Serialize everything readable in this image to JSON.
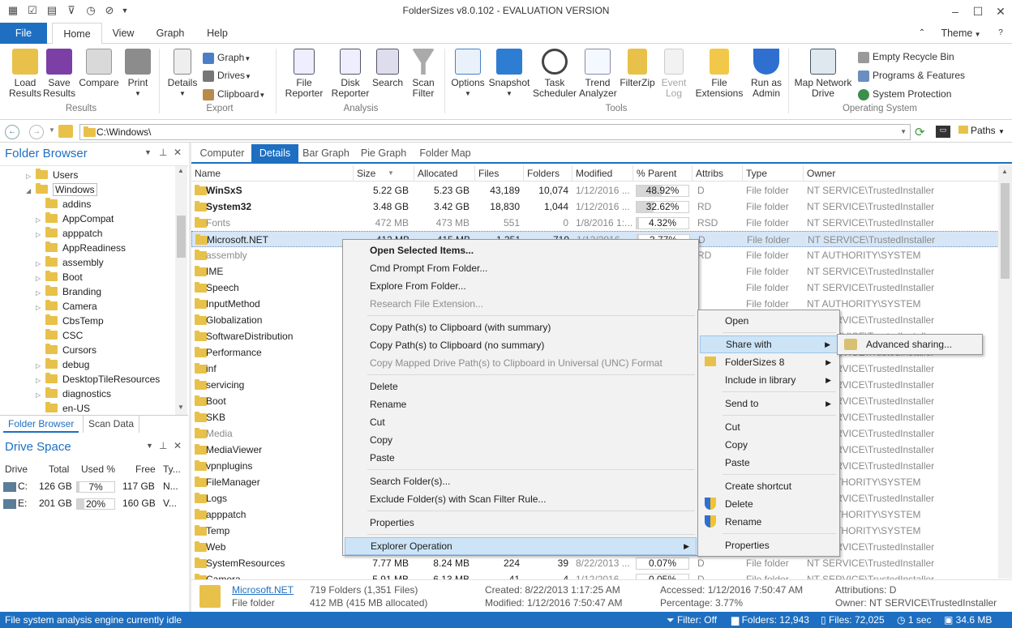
{
  "window": {
    "title": "FolderSizes v8.0.102 - EVALUATION VERSION"
  },
  "ribbon_tabs": {
    "file": "File",
    "home": "Home",
    "view": "View",
    "graph": "Graph",
    "help": "Help",
    "theme": "Theme"
  },
  "ribbon": {
    "load_results": "Load Results",
    "save_results": "Save Results",
    "compare": "Compare",
    "print": "Print",
    "results_group": "Results",
    "details": "Details",
    "graph": "Graph",
    "drives": "Drives",
    "clipboard": "Clipboard",
    "export_group": "Export",
    "file_reporter": "File Reporter",
    "disk_reporter": "Disk Reporter",
    "search": "Search",
    "scan_filter": "Scan Filter",
    "analysis_group": "Analysis",
    "options": "Options",
    "snapshot": "Snapshot",
    "task_scheduler": "Task Scheduler",
    "trend_analyzer": "Trend Analyzer",
    "filterzip": "FilterZip",
    "event_log": "Event Log",
    "file_extensions": "File Extensions",
    "run_as_admin": "Run as Admin",
    "tools_group": "Tools",
    "map_network_drive": "Map Network Drive",
    "empty_recycle_bin": "Empty Recycle Bin",
    "programs_features": "Programs & Features",
    "system_protection": "System Protection",
    "os_group": "Operating System"
  },
  "address": {
    "path": "C:\\Windows\\",
    "paths_label": "Paths"
  },
  "folder_browser": {
    "title": "Folder Browser",
    "items": [
      "Users",
      "Windows",
      "addins",
      "AppCompat",
      "apppatch",
      "AppReadiness",
      "assembly",
      "Boot",
      "Branding",
      "Camera",
      "CbsTemp",
      "CSC",
      "Cursors",
      "debug",
      "DesktopTileResources",
      "diagnostics",
      "en-US"
    ],
    "tab_browser": "Folder Browser",
    "tab_scan": "Scan Data"
  },
  "drive_space": {
    "title": "Drive Space",
    "headers": [
      "Drive",
      "Total",
      "Used %",
      "Free",
      "Ty..."
    ],
    "drives": [
      {
        "drive": "C:",
        "total": "126 GB",
        "used": "7%",
        "used_frac": 0.07,
        "free": "117 GB",
        "type": "N..."
      },
      {
        "drive": "E:",
        "total": "201 GB",
        "used": "20%",
        "used_frac": 0.2,
        "free": "160 GB",
        "type": "V..."
      }
    ]
  },
  "view_tabs": [
    "Computer",
    "Details",
    "Bar Graph",
    "Pie Graph",
    "Folder Map"
  ],
  "columns": [
    "Name",
    "Size",
    "Allocated",
    "Files",
    "Folders",
    "Modified",
    "% Parent",
    "Attribs",
    "Type",
    "Owner"
  ],
  "rows": [
    {
      "name": "WinSxS",
      "size": "5.22 GB",
      "alloc": "5.23 GB",
      "files": "43,189",
      "folders": "10,074",
      "mod": "1/12/2016 ...",
      "pct": "48.92%",
      "pct_frac": 0.4892,
      "attr": "D",
      "type": "File folder",
      "owner": "NT SERVICE\\TrustedInstaller"
    },
    {
      "name": "System32",
      "size": "3.48 GB",
      "alloc": "3.42 GB",
      "files": "18,830",
      "folders": "1,044",
      "mod": "1/12/2016 ...",
      "pct": "32.62%",
      "pct_frac": 0.3262,
      "attr": "RD",
      "type": "File folder",
      "owner": "NT SERVICE\\TrustedInstaller"
    },
    {
      "name": "Fonts",
      "size": "472 MB",
      "alloc": "473 MB",
      "files": "551",
      "folders": "0",
      "mod": "1/8/2016 1:...",
      "pct": "4.32%",
      "pct_frac": 0.0432,
      "attr": "RSD",
      "type": "File folder",
      "owner": "NT SERVICE\\TrustedInstaller"
    },
    {
      "name": "Microsoft.NET",
      "size": "412 MB",
      "alloc": "415 MB",
      "files": "1,351",
      "folders": "719",
      "mod": "1/12/2016 ...",
      "pct": "3.77%",
      "pct_frac": 0.0377,
      "attr": "D",
      "type": "File folder",
      "owner": "NT SERVICE\\TrustedInstaller"
    },
    {
      "name": "assembly",
      "type": "File folder",
      "attr": "RD",
      "owner": "NT AUTHORITY\\SYSTEM"
    },
    {
      "name": "IME",
      "type": "File folder",
      "attr": "",
      "owner": "NT SERVICE\\TrustedInstaller"
    },
    {
      "name": "Speech",
      "type": "File folder",
      "attr": "",
      "owner": "NT SERVICE\\TrustedInstaller"
    },
    {
      "name": "InputMethod",
      "type": "File folder",
      "attr": "",
      "owner": "NT AUTHORITY\\SYSTEM"
    },
    {
      "name": "Globalization",
      "owner": "NT SERVICE\\TrustedInstaller"
    },
    {
      "name": "SoftwareDistribution",
      "owner": "NT SERVICE\\TrustedInstaller"
    },
    {
      "name": "Performance",
      "owner": "NT SERVICE\\TrustedInstaller"
    },
    {
      "name": "inf",
      "owner": "NT SERVICE\\TrustedInstaller"
    },
    {
      "name": "servicing",
      "owner": "NT SERVICE\\TrustedInstaller"
    },
    {
      "name": "Boot",
      "owner": "NT SERVICE\\TrustedInstaller"
    },
    {
      "name": "SKB",
      "owner": "NT SERVICE\\TrustedInstaller"
    },
    {
      "name": "Media",
      "owner": "NT SERVICE\\TrustedInstaller"
    },
    {
      "name": "MediaViewer",
      "owner": "NT SERVICE\\TrustedInstaller"
    },
    {
      "name": "vpnplugins",
      "owner": "NT SERVICE\\TrustedInstaller"
    },
    {
      "name": "FileManager",
      "owner": "NT AUTHORITY\\SYSTEM"
    },
    {
      "name": "Logs",
      "owner": "NT SERVICE\\TrustedInstaller"
    },
    {
      "name": "apppatch",
      "owner": "NT AUTHORITY\\SYSTEM"
    },
    {
      "name": "Temp",
      "owner": "NT AUTHORITY\\SYSTEM"
    },
    {
      "name": "Web",
      "owner": "NT SERVICE\\TrustedInstaller"
    },
    {
      "name": "SystemResources",
      "size": "7.77 MB",
      "alloc": "8.24 MB",
      "files": "224",
      "folders": "39",
      "mod": "8/22/2013 ...",
      "pct": "0.07%",
      "pct_frac": 0.0007,
      "attr": "D",
      "type": "File folder",
      "owner": "NT SERVICE\\TrustedInstaller"
    },
    {
      "name": "Camera",
      "size": "5.91 MB",
      "alloc": "6.13 MB",
      "files": "41",
      "folders": "4",
      "mod": "1/12/2016 ...",
      "pct": "0.05%",
      "pct_frac": 0.0005,
      "attr": "D",
      "type": "File folder",
      "owner": "NT SERVICE\\TrustedInstaller"
    }
  ],
  "context_menu": {
    "items": [
      "Open Selected Items...",
      "Cmd Prompt From Folder...",
      "Explore From Folder...",
      "Research File Extension...",
      "Copy Path(s) to Clipboard (with summary)",
      "Copy Path(s) to Clipboard (no summary)",
      "Copy Mapped Drive Path(s) to Clipboard in Universal (UNC) Format",
      "Delete",
      "Rename",
      "Cut",
      "Copy",
      "Paste",
      "Search Folder(s)...",
      "Exclude Folder(s) with Scan Filter Rule...",
      "Properties",
      "Explorer Operation"
    ]
  },
  "explorer_menu": {
    "items": [
      "Open",
      "Share with",
      "FolderSizes 8",
      "Include in library",
      "Send to",
      "Cut",
      "Copy",
      "Paste",
      "Create shortcut",
      "Delete",
      "Rename",
      "Properties"
    ]
  },
  "share_menu": {
    "items": [
      "Advanced sharing..."
    ]
  },
  "summary": {
    "name": "Microsoft.NET",
    "kind": "File folder",
    "counts": "719 Folders (1,351 Files)",
    "size": "412 MB (415 MB allocated)",
    "created": "Created: 8/22/2013 1:17:25 AM",
    "modified": "Modified: 1/12/2016 7:50:47 AM",
    "accessed": "Accessed: 1/12/2016 7:50:47 AM",
    "percentage": "Percentage: 3.77%",
    "attributes": "Attributions: D",
    "owner": "Owner: NT SERVICE\\TrustedInstaller"
  },
  "status": {
    "engine": "File system analysis engine currently idle",
    "filter": "Filter: Off",
    "folders": "Folders: 12,943",
    "files": "Files: 72,025",
    "time": "1 sec",
    "mem": "34.6 MB"
  }
}
